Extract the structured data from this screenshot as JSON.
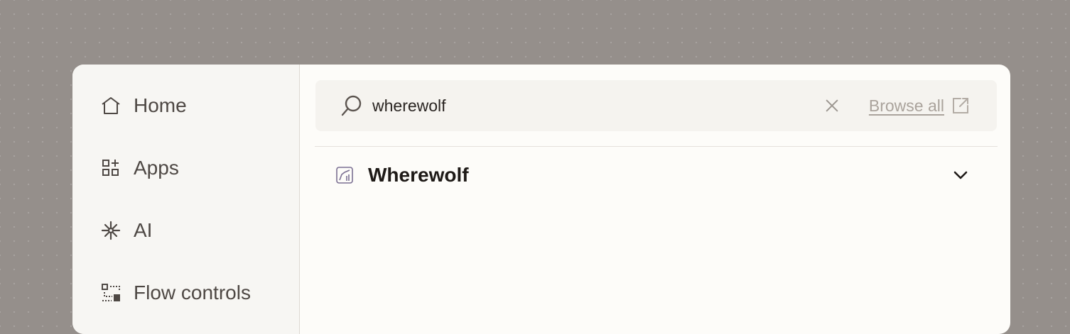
{
  "sidebar": {
    "items": [
      {
        "label": "Home",
        "icon": "home-icon"
      },
      {
        "label": "Apps",
        "icon": "apps-icon"
      },
      {
        "label": "AI",
        "icon": "ai-sparkle-icon"
      },
      {
        "label": "Flow controls",
        "icon": "flow-controls-icon"
      }
    ]
  },
  "search": {
    "value": "wherewolf",
    "placeholder": "",
    "browse_all_label": "Browse all"
  },
  "results": [
    {
      "title": "Wherewolf",
      "icon": "wherewolf-app-icon"
    }
  ],
  "colors": {
    "backdrop": "#958f8b",
    "panel": "#fdfcf9",
    "sidebar": "#f7f6f3",
    "text": "#4e4844",
    "muted": "#aaa39c",
    "app_icon": "#7b6f92"
  }
}
